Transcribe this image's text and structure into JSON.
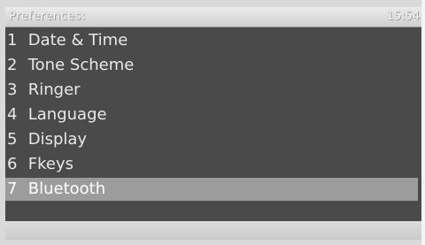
{
  "header": {
    "title": "Preferences:",
    "time": "15:54"
  },
  "menu": {
    "items": [
      {
        "number": "1",
        "label": "Date & Time"
      },
      {
        "number": "2",
        "label": "Tone Scheme"
      },
      {
        "number": "3",
        "label": "Ringer"
      },
      {
        "number": "4",
        "label": "Language"
      },
      {
        "number": "5",
        "label": "Display"
      },
      {
        "number": "6",
        "label": "Fkeys"
      },
      {
        "number": "7",
        "label": "Bluetooth"
      }
    ],
    "selected_index": 6
  }
}
